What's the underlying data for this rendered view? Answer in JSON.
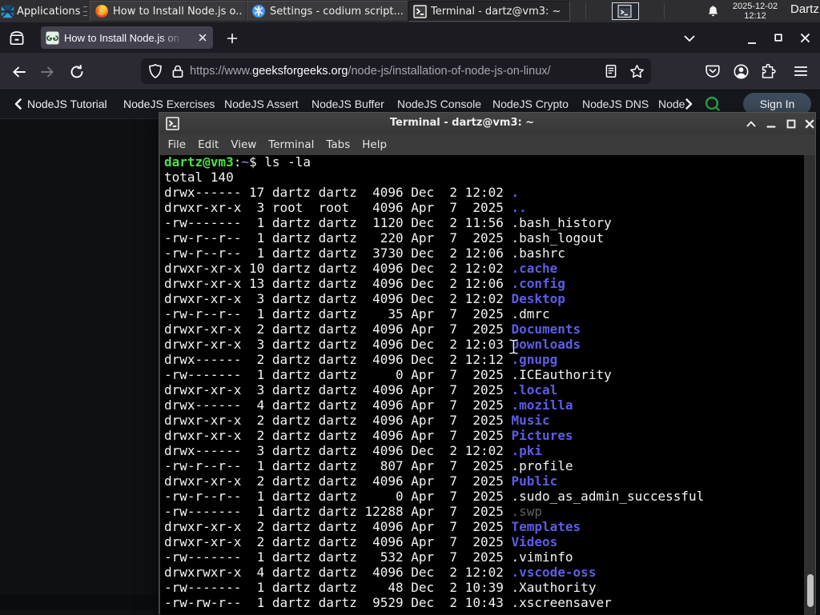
{
  "panel": {
    "applications_label": "Applications",
    "distro_logo": "distro-logo-icon",
    "windows": [
      {
        "title": "How to Install Node.js o...",
        "icon": "firefox-icon",
        "active": false
      },
      {
        "title": "Settings - codium script...",
        "icon": "vscodium-icon",
        "active": false
      },
      {
        "title": "Terminal - dartz@vm3: ~",
        "icon": "terminal-icon",
        "active": true
      }
    ],
    "workspace_switcher": "workspace-1-terminal",
    "clock_date": "2025-12-02",
    "clock_time": "12:12",
    "user": "Dartz"
  },
  "browser": {
    "tab": {
      "title": "How to Install Node.js on Linux?",
      "favicon": "geeksforgeeks-icon"
    },
    "url": {
      "scheme": "https://www.",
      "host": "geeksforgeeks.org",
      "path": "/node-js/installation-of-node-js-on-linux/"
    }
  },
  "site_nav": {
    "items": [
      "NodeJS Tutorial",
      "NodeJS Exercises",
      "NodeJS Assert",
      "NodeJS Buffer",
      "NodeJS Console",
      "NodeJS Crypto",
      "NodeJS DNS",
      "Node"
    ],
    "sign_in_label": "Sign In"
  },
  "terminal": {
    "title": "Terminal - dartz@vm3: ~",
    "menu": [
      "File",
      "Edit",
      "View",
      "Terminal",
      "Tabs",
      "Help"
    ],
    "command": "ls -la",
    "lines": [
      [
        [
          "dartz@vm3",
          "g"
        ],
        [
          ":",
          ""
        ],
        [
          "~",
          "t"
        ],
        [
          "$ ls -la",
          ""
        ]
      ],
      [
        [
          "total 140",
          ""
        ]
      ],
      [
        [
          "drwx------ 17 dartz dartz  4096 Dec  2 12:02 ",
          ""
        ],
        [
          ".",
          "b"
        ]
      ],
      [
        [
          "drwxr-xr-x  3 root  root   4096 Apr  7  2025 ",
          ""
        ],
        [
          "..",
          "b"
        ]
      ],
      [
        [
          "-rw-------  1 dartz dartz  1120 Dec  2 11:56 ",
          ""
        ],
        [
          ".bash_history",
          ""
        ]
      ],
      [
        [
          "-rw-r--r--  1 dartz dartz   220 Apr  7  2025 ",
          ""
        ],
        [
          ".bash_logout",
          ""
        ]
      ],
      [
        [
          "-rw-r--r--  1 dartz dartz  3730 Dec  2 12:06 ",
          ""
        ],
        [
          ".bashrc",
          ""
        ]
      ],
      [
        [
          "drwxr-xr-x 10 dartz dartz  4096 Dec  2 12:02 ",
          ""
        ],
        [
          ".cache",
          "b"
        ]
      ],
      [
        [
          "drwxr-xr-x 13 dartz dartz  4096 Dec  2 12:06 ",
          ""
        ],
        [
          ".config",
          "b"
        ]
      ],
      [
        [
          "drwxr-xr-x  3 dartz dartz  4096 Dec  2 12:02 ",
          ""
        ],
        [
          "Desktop",
          "b"
        ]
      ],
      [
        [
          "-rw-r--r--  1 dartz dartz    35 Apr  7  2025 ",
          ""
        ],
        [
          ".dmrc",
          ""
        ]
      ],
      [
        [
          "drwxr-xr-x  2 dartz dartz  4096 Apr  7  2025 ",
          ""
        ],
        [
          "Documents",
          "b"
        ]
      ],
      [
        [
          "drwxr-xr-x  3 dartz dartz  4096 Dec  2 12:03 ",
          ""
        ],
        [
          "Downloads",
          "b"
        ]
      ],
      [
        [
          "drwx------  2 dartz dartz  4096 Dec  2 12:12 ",
          ""
        ],
        [
          ".gnupg",
          "b"
        ]
      ],
      [
        [
          "-rw-------  1 dartz dartz     0 Apr  7  2025 ",
          ""
        ],
        [
          ".ICEauthority",
          ""
        ]
      ],
      [
        [
          "drwxr-xr-x  3 dartz dartz  4096 Apr  7  2025 ",
          ""
        ],
        [
          ".local",
          "b"
        ]
      ],
      [
        [
          "drwx------  4 dartz dartz  4096 Apr  7  2025 ",
          ""
        ],
        [
          ".mozilla",
          "b"
        ]
      ],
      [
        [
          "drwxr-xr-x  2 dartz dartz  4096 Apr  7  2025 ",
          ""
        ],
        [
          "Music",
          "b"
        ]
      ],
      [
        [
          "drwxr-xr-x  2 dartz dartz  4096 Apr  7  2025 ",
          ""
        ],
        [
          "Pictures",
          "b"
        ]
      ],
      [
        [
          "drwx------  3 dartz dartz  4096 Dec  2 12:02 ",
          ""
        ],
        [
          ".pki",
          "b"
        ]
      ],
      [
        [
          "-rw-r--r--  1 dartz dartz   807 Apr  7  2025 ",
          ""
        ],
        [
          ".profile",
          ""
        ]
      ],
      [
        [
          "drwxr-xr-x  2 dartz dartz  4096 Apr  7  2025 ",
          ""
        ],
        [
          "Public",
          "b"
        ]
      ],
      [
        [
          "-rw-r--r--  1 dartz dartz     0 Apr  7  2025 ",
          ""
        ],
        [
          ".sudo_as_admin_successful",
          ""
        ]
      ],
      [
        [
          "-rw-------  1 dartz dartz 12288 Apr  7  2025 ",
          ""
        ],
        [
          ".swp",
          "d"
        ]
      ],
      [
        [
          "drwxr-xr-x  2 dartz dartz  4096 Apr  7  2025 ",
          ""
        ],
        [
          "Templates",
          "b"
        ]
      ],
      [
        [
          "drwxr-xr-x  2 dartz dartz  4096 Apr  7  2025 ",
          ""
        ],
        [
          "Videos",
          "b"
        ]
      ],
      [
        [
          "-rw-------  1 dartz dartz   532 Apr  7  2025 ",
          ""
        ],
        [
          ".viminfo",
          ""
        ]
      ],
      [
        [
          "drwxrwxr-x  4 dartz dartz  4096 Dec  2 12:02 ",
          ""
        ],
        [
          ".vscode-oss",
          "b"
        ]
      ],
      [
        [
          "-rw-------  1 dartz dartz    48 Dec  2 10:39 ",
          ""
        ],
        [
          ".Xauthority",
          ""
        ]
      ],
      [
        [
          "-rw-rw-r--  1 dartz dartz  9529 Dec  2 10:43 ",
          ""
        ],
        [
          ".xscreensaver",
          ""
        ]
      ]
    ]
  },
  "colors": {
    "accent_green": "#4ce24c",
    "dir_blue": "#605df0",
    "gfg_green": "#2da44e",
    "terminal_bg": "#000000",
    "panel_bg": "#2e2e30"
  }
}
